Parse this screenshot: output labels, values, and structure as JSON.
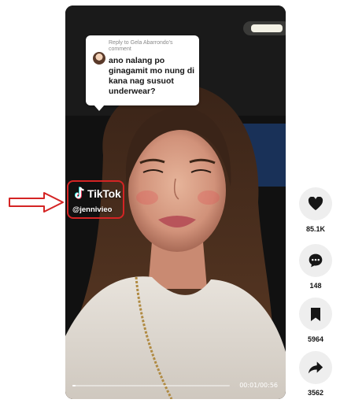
{
  "reply_card": {
    "meta": "Reply to Gela Abarrondo's comment",
    "text": "ano nalang po ginagamit mo nung di kana nag susuot underwear?"
  },
  "watermark": {
    "brand": "TikTok",
    "handle": "@jennivieo"
  },
  "player": {
    "time": "00:01/00:56",
    "progress": 0.02
  },
  "actions": [
    {
      "icon": "heart-icon",
      "count": "85.1K"
    },
    {
      "icon": "comment-icon",
      "count": "148"
    },
    {
      "icon": "bookmark-icon",
      "count": "5964"
    },
    {
      "icon": "share-icon",
      "count": "3562"
    }
  ],
  "colors": {
    "annotation": "#d42424",
    "rail_button": "#eeeeee"
  }
}
